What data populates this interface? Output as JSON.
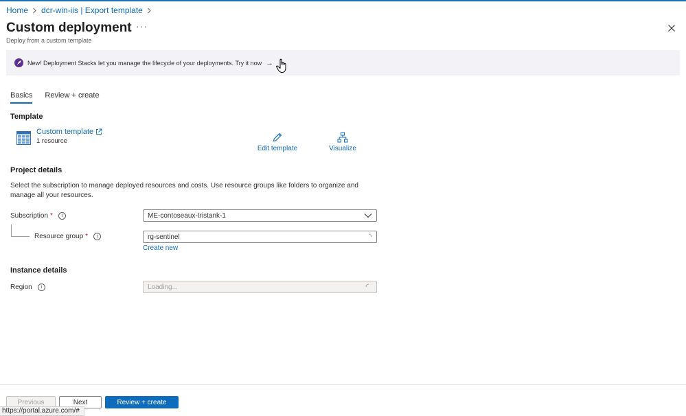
{
  "breadcrumb": {
    "items": [
      "Home",
      "dcr-win-iis | Export template"
    ]
  },
  "header": {
    "title": "Custom deployment",
    "more_label": "···",
    "subtitle": "Deploy from a custom template"
  },
  "banner": {
    "text": "New! Deployment Stacks let you manage the lifecycle of your deployments. Try it now",
    "arrow": "→"
  },
  "tabs": [
    {
      "label": "Basics",
      "active": true
    },
    {
      "label": "Review + create",
      "active": false
    }
  ],
  "template": {
    "section_title": "Template",
    "link_label": "Custom template",
    "resource_count": "1 resource",
    "edit_label": "Edit template",
    "visualize_label": "Visualize"
  },
  "project": {
    "section_title": "Project details",
    "description": "Select the subscription to manage deployed resources and costs. Use resource groups like folders to organize and manage all your resources.",
    "subscription_label": "Subscription",
    "subscription_value": "ME-contoseaux-tristank-1",
    "resource_group_label": "Resource group",
    "resource_group_value": "rg-sentinel",
    "create_new_label": "Create new",
    "required_mark": "*"
  },
  "instance": {
    "section_title": "Instance details",
    "region_label": "Region",
    "region_value": "Loading..."
  },
  "footer": {
    "previous_label": "Previous",
    "next_label": "Next",
    "review_label": "Review + create"
  },
  "status_bar": {
    "url": "https://portal.azure.com/#"
  },
  "colors": {
    "accent": "#0f6cbd",
    "banner_bg": "#f3f2f6",
    "rocket": "#5c2e91",
    "required": "#a4262c"
  }
}
